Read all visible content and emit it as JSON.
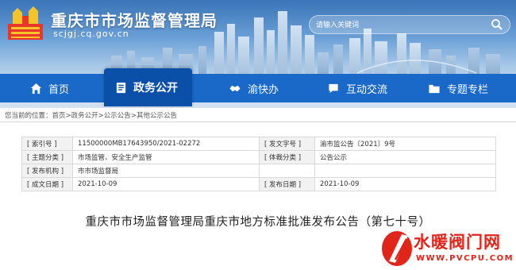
{
  "header": {
    "title": "重庆市市场监督管理局",
    "domain": "scjgj.cq.gov.cn",
    "search_placeholder": "请输入关键词"
  },
  "nav": {
    "items": [
      {
        "label": "首页",
        "icon": "home-icon"
      },
      {
        "label": "政务公开",
        "icon": "document-icon",
        "active": true
      },
      {
        "label": "渝快办",
        "icon": "handshake-icon"
      },
      {
        "label": "互动交流",
        "icon": "chat-icon"
      },
      {
        "label": "专题专栏",
        "icon": "folder-icon"
      }
    ]
  },
  "breadcrumb": {
    "prefix": "您当前的位置：",
    "items": [
      "首页",
      "政务公开",
      "公示公告",
      "其他公示公告"
    ],
    "separator": ">"
  },
  "info": {
    "rows": [
      {
        "l1": "[ 索引号 ]",
        "v1": "11500000MB17643950/2021-02272",
        "l2": "[ 发文字号 ]",
        "v2": "渝市监公告〔2021〕9号"
      },
      {
        "l1": "[ 主题分类 ]",
        "v1": "市场监管、安全生产监管",
        "l2": "[ 体裁分类 ]",
        "v2": "公告公示"
      },
      {
        "l1": "[ 发布机构 ]",
        "v1": "市市场监督局",
        "l2": "",
        "v2": ""
      },
      {
        "l1": "[ 成文日期 ]",
        "v1": "2021-10-09",
        "l2": "[ 发布日期 ]",
        "v2": "2021-10-09"
      }
    ]
  },
  "article": {
    "title": "重庆市市场监督管理局重庆市地方标准批准发布公告（第七十号）"
  },
  "watermark": {
    "text": "水暖阀门网",
    "url": "WWW.PVCPU.COM"
  },
  "colors": {
    "nav": "#1a69c8",
    "nav_active": "#0a4fa8",
    "watermark": "#e1251b"
  }
}
